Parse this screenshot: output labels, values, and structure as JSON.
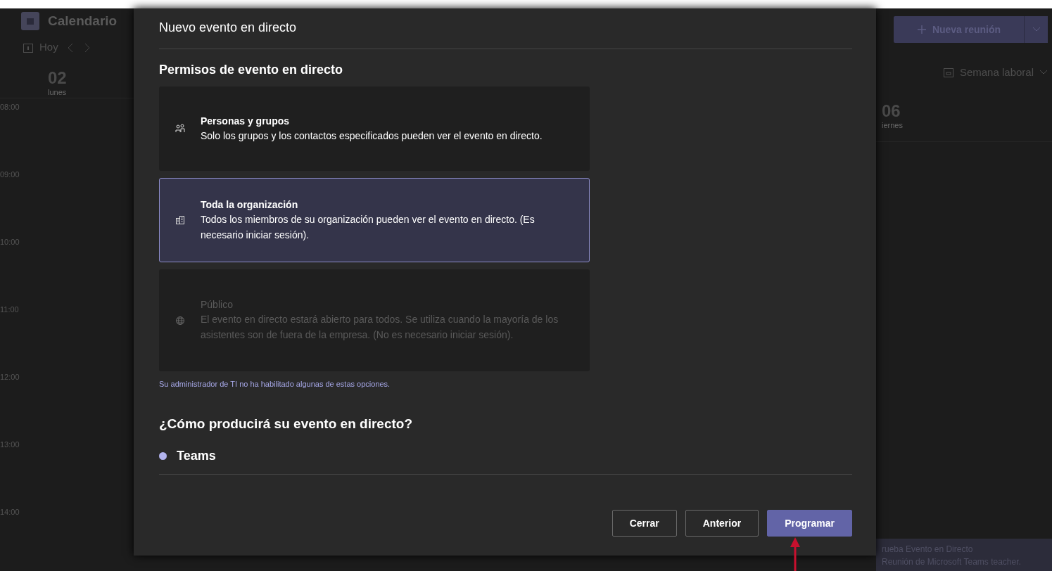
{
  "calendar": {
    "app_title": "Calendario",
    "today": "Hoy",
    "view": "Semana laboral",
    "new_meeting": "Nueva reunión",
    "days": [
      {
        "number": "02",
        "name": "lunes"
      },
      {
        "number": "06",
        "name": "iernes"
      }
    ],
    "hours": [
      "08:00",
      "09:00",
      "10:00",
      "11:00",
      "12:00",
      "13:00",
      "14:00"
    ],
    "event": {
      "title": "rueba Evento en Directo",
      "subtitle": "Reunión de Microsoft Teams  teacher."
    }
  },
  "dialog": {
    "title": "Nuevo evento en directo",
    "section_title": "Permisos de evento en directo",
    "options": [
      {
        "kind": "people",
        "title": "Personas y grupos",
        "description": "Solo los grupos y los contactos especificados pueden ver el evento en directo.",
        "selected": false,
        "disabled": false
      },
      {
        "kind": "organization",
        "title": "Toda la organización",
        "description": "Todos los miembros de su organización pueden ver el evento en directo. (Es necesario iniciar sesión).",
        "selected": true,
        "disabled": false
      },
      {
        "kind": "public",
        "title": "Público",
        "description": "El evento en directo estará abierto para todos. Se utiliza cuando la mayoría de los asistentes son de fuera de la empresa. (No es necesario iniciar sesión).",
        "selected": false,
        "disabled": true
      }
    ],
    "note": "Su administrador de TI no ha habilitado algunas de estas opciones.",
    "production_title": "¿Cómo producirá su evento en directo?",
    "production_options": [
      {
        "label": "Teams",
        "selected": true
      }
    ],
    "buttons": [
      {
        "label": "Cerrar",
        "kind": "secondary"
      },
      {
        "label": "Anterior",
        "kind": "secondary"
      },
      {
        "label": "Programar",
        "kind": "primary"
      }
    ]
  }
}
